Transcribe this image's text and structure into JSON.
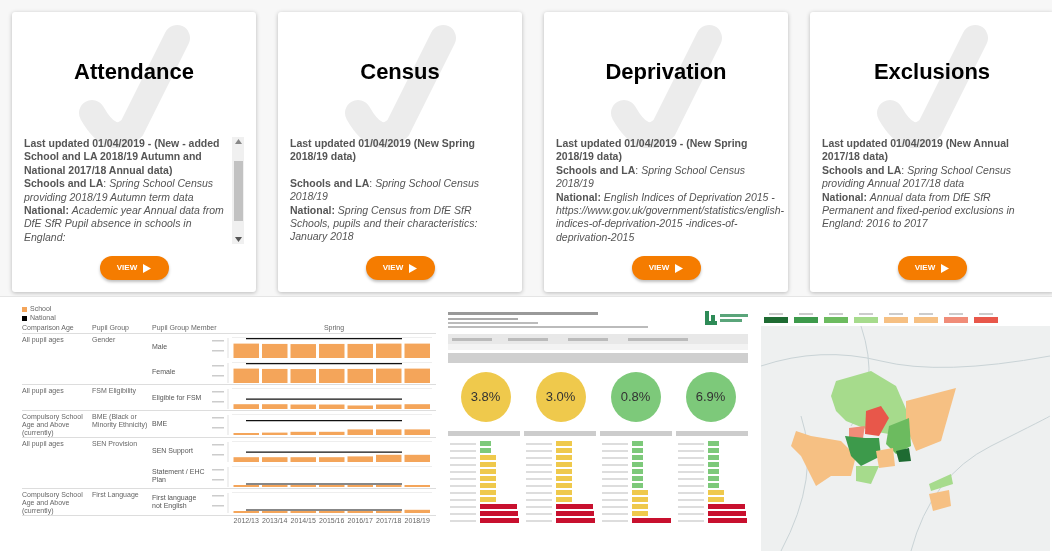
{
  "cards": [
    {
      "title": "Attendance",
      "scrollable": true,
      "separated": false,
      "lines": [
        {
          "kind": "updated",
          "text": "Last updated 01/04/2019 - (New - added School and LA 2018/19 Autumn and National 2017/18 Annual data)"
        },
        {
          "kind": "source",
          "text": "**Schools and LA**: *Spring School Census providing 2018/19 Autumn term data*"
        },
        {
          "kind": "source",
          "text": "**National:** *Academic year Annual data from DfE SfR Pupil absence in schools in England:*"
        }
      ],
      "button": "VIEW"
    },
    {
      "title": "Census",
      "scrollable": false,
      "separated": true,
      "lines": [
        {
          "kind": "updated",
          "text": "Last updated 01/04/2019 (New Spring 2018/19 data)"
        },
        {
          "kind": "source",
          "text": "**Schools and LA**: *Spring School Census 2018/19*"
        },
        {
          "kind": "source",
          "text": "**National:** *Spring Census from DfE SfR Schools, pupils and their characteristics: January 2018*"
        }
      ],
      "button": "VIEW"
    },
    {
      "title": "Deprivation",
      "scrollable": false,
      "separated": false,
      "lines": [
        {
          "kind": "updated",
          "text": "Last updated 01/04/2019 - (New Spring 2018/19 data)"
        },
        {
          "kind": "source",
          "text": "**Schools and LA**: *Spring School Census 2018/19*"
        },
        {
          "kind": "source",
          "text": "**National:** *English Indices of Deprivation 2015 - https://www.gov.uk/government/statistics/english-indices-of-deprivation-2015 -indices-of-deprivation-2015*"
        }
      ],
      "button": "VIEW"
    },
    {
      "title": "Exclusions",
      "scrollable": false,
      "separated": false,
      "lines": [
        {
          "kind": "updated",
          "text": "Last updated 01/04/2019 (New Annual 2017/18 data)"
        },
        {
          "kind": "source",
          "text": "**Schools and LA**: *Spring School Census providing Annual 2017/18 data*"
        },
        {
          "kind": "source",
          "text": "**National:** *Annual data from DfE SfR Permanent and fixed-period exclusions in England: 2016 to 2017*"
        }
      ],
      "button": "VIEW"
    }
  ],
  "previews": [
    {
      "kind": "pupil-groups",
      "legend": [
        {
          "label": "School",
          "color": "#f4a55a"
        },
        {
          "label": "National",
          "color": "#000000"
        }
      ],
      "columns": [
        "Comparison Age",
        "Pupil Group",
        "Pupil Group Member"
      ],
      "period": "Spring",
      "groups": [
        {
          "age": "All pupil ages",
          "group": "Gender",
          "members": [
            "Male",
            "Female"
          ]
        },
        {
          "age": "All pupil ages",
          "group": "FSM Eligibility",
          "members": [
            "Eligible for FSM"
          ]
        },
        {
          "age": "Compulsory School Age and Above (currently)",
          "group": "BME (Black or Minority Ethnicity)",
          "members": [
            "BME"
          ]
        },
        {
          "age": "All pupil ages",
          "group": "SEN Provision",
          "members": [
            "SEN Support",
            "Statement / EHC Plan"
          ]
        },
        {
          "age": "Compulsory School Age and Above (currently)",
          "group": "First Language",
          "members": [
            "First language not English"
          ]
        }
      ],
      "years": [
        "2012/13",
        "2013/14",
        "2014/15",
        "2015/16",
        "2016/17",
        "2017/18",
        "2018/19"
      ]
    },
    {
      "kind": "headline",
      "circles": [
        {
          "value": "3.8%",
          "color": "#efc94c"
        },
        {
          "value": "3.0%",
          "color": "#efc94c"
        },
        {
          "value": "0.8%",
          "color": "#7dc97a"
        },
        {
          "value": "6.9%",
          "color": "#7dc97a"
        }
      ]
    },
    {
      "kind": "map"
    }
  ]
}
